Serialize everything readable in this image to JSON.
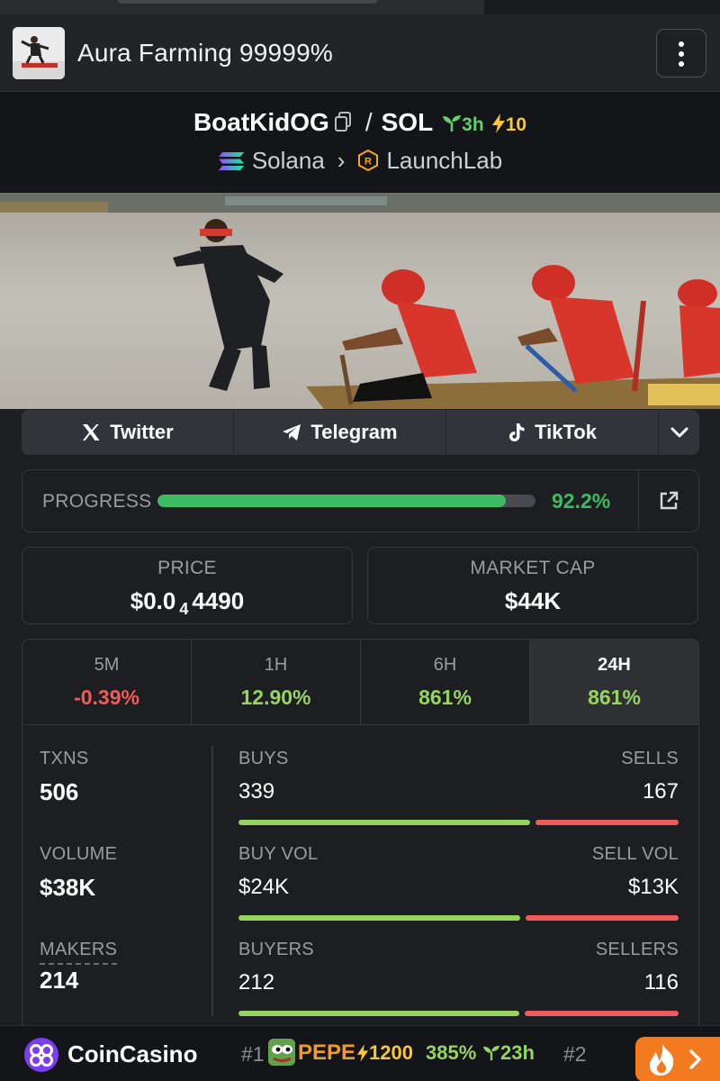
{
  "header": {
    "title": "Aura Farming 99999%"
  },
  "pair": {
    "base": "BoatKidOG",
    "quote": "SOL",
    "age": "3h",
    "boosts": "10",
    "chain": "Solana",
    "dex": "LaunchLab"
  },
  "socials": [
    {
      "label": "Twitter",
      "icon": "x-icon"
    },
    {
      "label": "Telegram",
      "icon": "telegram-icon"
    },
    {
      "label": "TikTok",
      "icon": "tiktok-icon"
    }
  ],
  "progress": {
    "label": "PROGRESS",
    "value": 92.2,
    "text": "92.2%"
  },
  "price": {
    "label": "PRICE",
    "prefix": "$0.0",
    "zeros": "4",
    "digits": "4490"
  },
  "market_cap": {
    "label": "MARKET CAP",
    "value": "$44K"
  },
  "timeframes": [
    {
      "label": "5M",
      "change": "-0.39%"
    },
    {
      "label": "1H",
      "change": "12.90%"
    },
    {
      "label": "6H",
      "change": "861%"
    },
    {
      "label": "24H",
      "change": "861%",
      "active": true
    }
  ],
  "metrics": {
    "txns": {
      "label": "TXNS",
      "value": "506"
    },
    "volume": {
      "label": "VOLUME",
      "value": "$38K"
    },
    "makers": {
      "label": "MAKERS",
      "value": "214"
    },
    "buys": {
      "label": "BUYS",
      "value": "339",
      "count": 339
    },
    "sells": {
      "label": "SELLS",
      "value": "167",
      "count": 167
    },
    "buy_vol": {
      "label": "BUY VOL",
      "value": "$24K",
      "amount": 24
    },
    "sell_vol": {
      "label": "SELL VOL",
      "value": "$13K",
      "amount": 13
    },
    "buyers": {
      "label": "BUYERS",
      "value": "212",
      "count": 212
    },
    "sellers": {
      "label": "SELLERS",
      "value": "116",
      "count": 116
    }
  },
  "ticker": {
    "brand": "CoinCasino",
    "rank1": "#1",
    "token": "PEPE",
    "boost": "1200",
    "change": "385%",
    "age": "23h",
    "rank2": "#2"
  },
  "colors": {
    "positive": "#96d35f",
    "negative": "#ef5a5a",
    "progress": "#3dbb62",
    "boost": "#f6c63b",
    "brand_orange": "#f47a1f"
  }
}
